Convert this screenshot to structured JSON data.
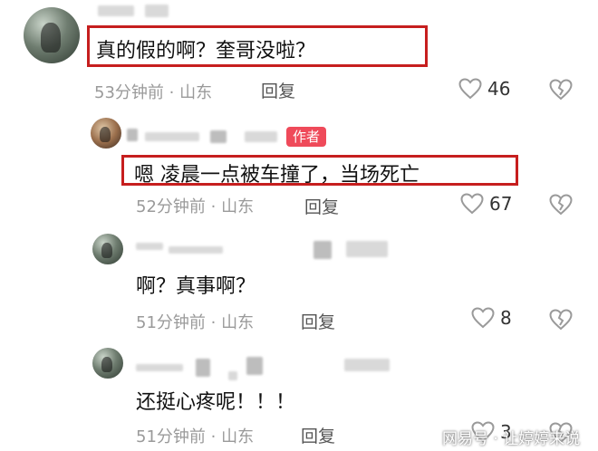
{
  "comments": [
    {
      "text": "真的假的啊？奎哥没啦？",
      "meta": "53分钟前 · 山东",
      "reply": "回复",
      "likes": "46"
    },
    {
      "badge": "作者",
      "text": "嗯 凌晨一点被车撞了，当场死亡",
      "meta": "52分钟前 · 山东",
      "reply": "回复",
      "likes": "67"
    },
    {
      "text": "啊？真事啊？",
      "meta": "51分钟前 · 山东",
      "reply": "回复",
      "likes": "8"
    },
    {
      "text": "还挺心疼呢！！！",
      "meta": "51分钟前 · 山东",
      "reply": "回复",
      "likes": "3"
    }
  ],
  "watermark": "网易号 · 让婷婷来说",
  "colors": {
    "highlight": "#c61e1e",
    "badge": "#ef4a5a",
    "meta": "#9a9a9a"
  },
  "icons": {
    "like": "heart-outline-icon",
    "dislike": "broken-heart-icon"
  }
}
